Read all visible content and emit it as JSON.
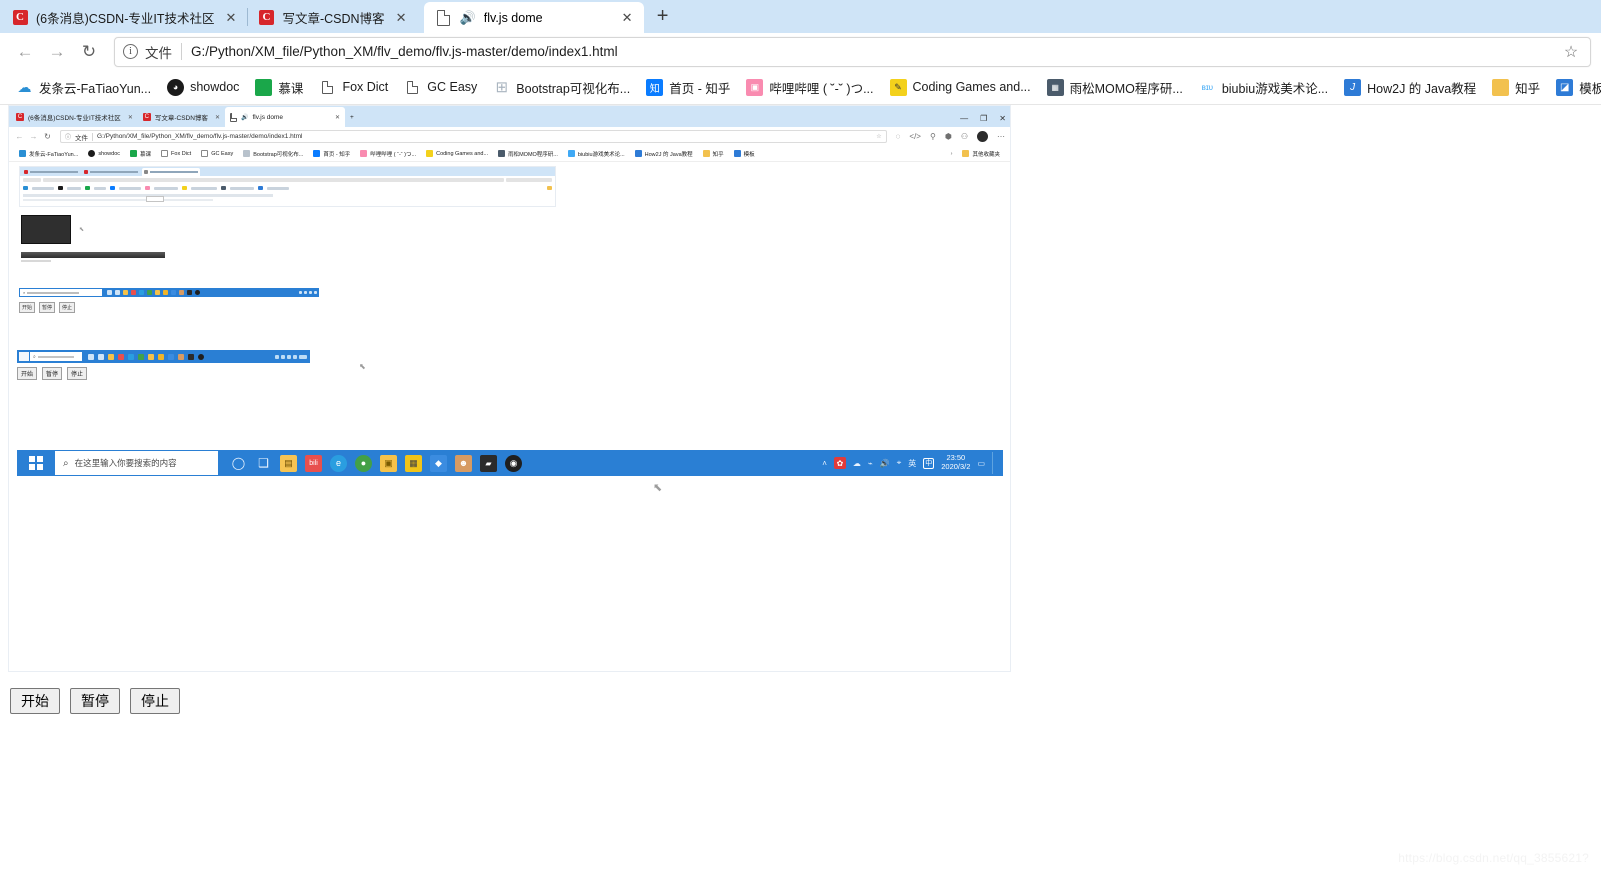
{
  "browser": {
    "tabs": [
      {
        "title": "(6条消息)CSDN-专业IT技术社区",
        "icon": "csdn-icon",
        "active": false,
        "close": "✕"
      },
      {
        "title": "写文章-CSDN博客",
        "icon": "csdn-icon",
        "active": false,
        "close": "✕"
      },
      {
        "title": "flv.js dome",
        "icon": "document-audio-icon",
        "active": true,
        "close": "✕"
      }
    ],
    "new_tab_label": "+",
    "nav": {
      "back": "←",
      "forward": "→",
      "reload": "↻"
    },
    "omnibox": {
      "info_icon": "ⓘ",
      "scheme_label": "文件",
      "url": "G:/Python/XM_file/Python_XM/flv_demo/flv.js-master/demo/index1.html",
      "star_icon": "☆"
    },
    "bookmarks": [
      {
        "label": "发条云-FaTiaoYun...",
        "icon": "cloud-icon",
        "color": "#2a8fd4",
        "glyph": "☁"
      },
      {
        "label": "showdoc",
        "icon": "showdoc-icon",
        "color": "#1b1b1b",
        "glyph": "◕"
      },
      {
        "label": "慕课",
        "icon": "book-icon",
        "color": "#1aa74a",
        "glyph": "▰"
      },
      {
        "label": "Fox Dict",
        "icon": "page-icon",
        "color": "#ffffff",
        "glyph": "▢"
      },
      {
        "label": "GC Easy",
        "icon": "page-icon",
        "color": "#ffffff",
        "glyph": "▢"
      },
      {
        "label": "Bootstrap可视化布...",
        "icon": "grid-icon",
        "color": "#a9b4bf",
        "glyph": "⊞"
      },
      {
        "label": "首页 - 知乎",
        "icon": "zhihu-icon",
        "color": "#0a7cff",
        "glyph": "知"
      },
      {
        "label": "哔哩哔哩 ( ˘-˘ )つ...",
        "icon": "bilibili-icon",
        "color": "#f98bb0",
        "glyph": "▣"
      },
      {
        "label": "Coding Games and...",
        "icon": "codingame-icon",
        "color": "#f3d11c",
        "glyph": "✎"
      },
      {
        "label": "雨松MOMO程序研...",
        "icon": "momo-icon",
        "color": "#4b5b6b",
        "glyph": "▦"
      },
      {
        "label": "biubiu游戏美术论...",
        "icon": "biubiu-icon",
        "color": "#3fa9f5",
        "glyph": "ʙɪᴜ"
      },
      {
        "label": "How2J 的 Java教程",
        "icon": "how2j-icon",
        "color": "#2e7bd6",
        "glyph": "J"
      },
      {
        "label": "知乎",
        "icon": "folder-icon",
        "color": "#f2c14e",
        "glyph": "▤"
      },
      {
        "label": "模板",
        "icon": "template-icon",
        "color": "#2e7bd6",
        "glyph": "◪"
      }
    ]
  },
  "page": {
    "screenshot": {
      "description": "nested-screenshot-of-same-browser",
      "inner_browser": {
        "tabs": [
          "(6条消息)CSDN-专业IT技术社区",
          "写文章-CSDN博客",
          "flv.js dome"
        ],
        "url": "G:/Python/XM_file/Python_XM/flv_demo/flv.js-master/demo/index1.html",
        "scheme_label": "文件",
        "window_controls": [
          "—",
          "▢",
          "✕"
        ],
        "bookmarks_overflow": "其他收藏夹"
      },
      "taskbar": {
        "search_placeholder": "在这里输入你要搜索的内容",
        "clock_time": "23:50",
        "clock_date": "2020/3/2"
      },
      "inner_buttons": [
        "开始",
        "暂停",
        "停止"
      ]
    },
    "controls": {
      "start": "开始",
      "pause": "暂停",
      "stop": "停止"
    }
  },
  "watermark": "https://blog.csdn.net/qq_3855621?"
}
